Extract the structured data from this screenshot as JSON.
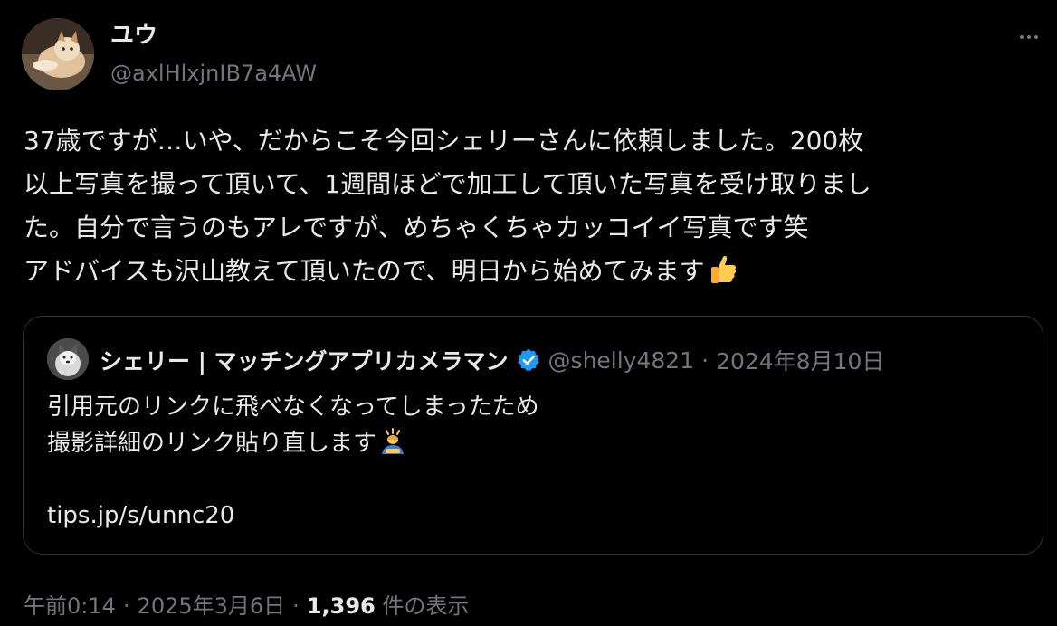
{
  "author": {
    "display_name": "ユウ",
    "handle": "@axlHlxjnIB7a4AW",
    "avatar_icon": "cat-photo-avatar"
  },
  "more_icon": "more-horizontal-icon",
  "tweet": {
    "lines": [
      "37歳ですが…いや、だからこそ今回シェリーさんに依頼しました。200枚",
      "以上写真を撮って頂いて、1週間ほどで加工して頂いた写真を受け取りまし",
      "た。自分で言うのもアレですが、めちゃくちゃカッコイイ写真です笑",
      "アドバイスも沢山教えて頂いたので、明日から始めてみます"
    ],
    "trailing_emoji": "thumbs-up-icon"
  },
  "quoted": {
    "display_name": "シェリー | マッチングアプリカメラマン",
    "verified_icon": "verified-badge-icon",
    "handle": "@shelly4821",
    "separator": "·",
    "date": "2024年8月10日",
    "lines": [
      "引用元のリンクに飛べなくなってしまったため",
      "撮影詳細のリンク貼り直します"
    ],
    "trailing_emoji": "person-bowing-icon",
    "link": "tips.jp/s/unnc20"
  },
  "meta": {
    "time": "午前0:14",
    "separator": "·",
    "date": "2025年3月6日",
    "views_count": "1,396",
    "views_label": "件の表示"
  },
  "colors": {
    "background": "#000000",
    "text": "#e7e9ea",
    "secondary": "#71767b",
    "border": "#2f3336",
    "verified": "#1d9bf0"
  }
}
